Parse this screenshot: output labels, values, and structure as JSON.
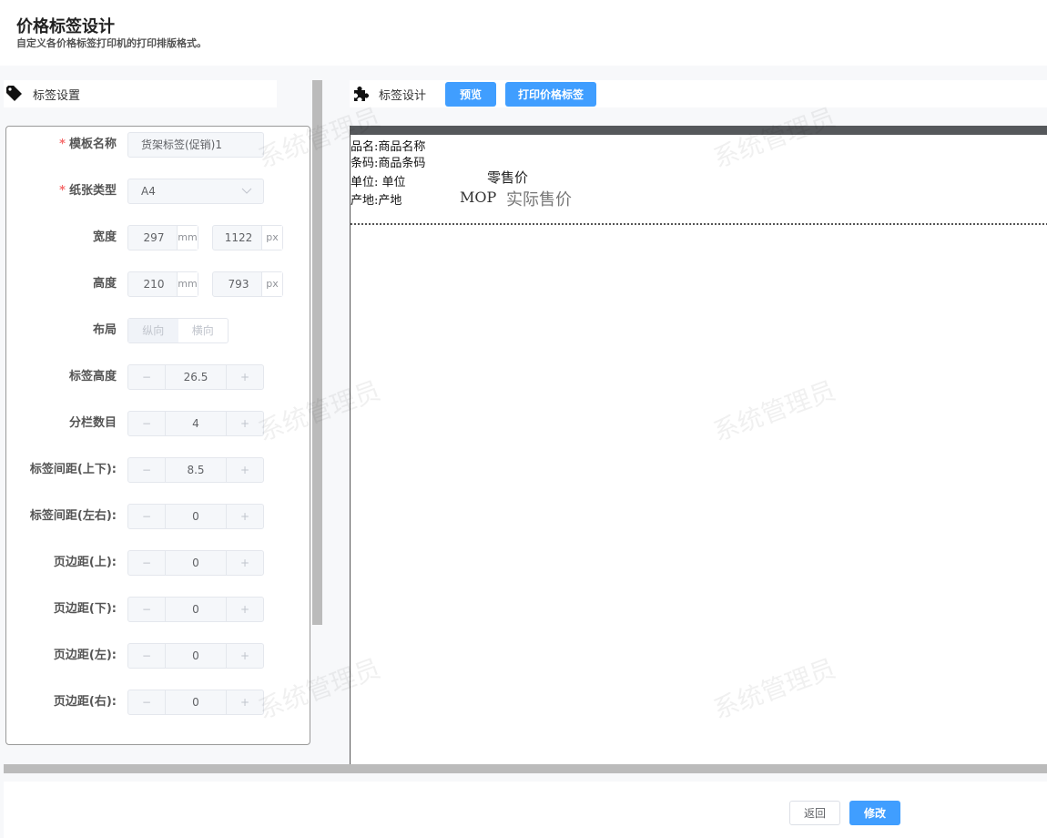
{
  "header": {
    "title": "价格标签设计",
    "subtitle": "自定义各价格标签打印机的打印排版格式。"
  },
  "left_panel": {
    "title": "标签设置",
    "template_name": {
      "label": "模板名称",
      "value": "货架标签(促销)1"
    },
    "paper_type": {
      "label": "纸张类型",
      "value": "A4"
    },
    "width": {
      "label": "宽度",
      "mm": "297",
      "mm_unit": "mm",
      "px": "1122",
      "px_unit": "px"
    },
    "height": {
      "label": "高度",
      "mm": "210",
      "mm_unit": "mm",
      "px": "793",
      "px_unit": "px"
    },
    "layout": {
      "label": "布局",
      "options": [
        "纵向",
        "横向"
      ]
    },
    "steppers": [
      {
        "label": "标签高度",
        "value": "26.5"
      },
      {
        "label": "分栏数目",
        "value": "4"
      },
      {
        "label": "标签间距(上下):",
        "value": "8.5"
      },
      {
        "label": "标签间距(左右):",
        "value": "0"
      },
      {
        "label": "页边距(上):",
        "value": "0"
      },
      {
        "label": "页边距(下):",
        "value": "0"
      },
      {
        "label": "页边距(左):",
        "value": "0"
      },
      {
        "label": "页边距(右):",
        "value": "0"
      }
    ],
    "minus": "−",
    "plus": "+"
  },
  "right_panel": {
    "title": "标签设计",
    "preview_label": "预览",
    "print_label": "打印价格标签"
  },
  "label": {
    "name": "品名:商品名称",
    "barcode": "条码:商品条码",
    "unit": "单位: 单位",
    "origin": "产地:产地",
    "retail": "零售价",
    "mop": "MOP",
    "actual": "实际售价"
  },
  "footer": {
    "back": "返回",
    "modify": "修改"
  },
  "watermark": "系统管理员",
  "colors": {
    "primary": "#409eff",
    "required": "#f56c6c"
  }
}
